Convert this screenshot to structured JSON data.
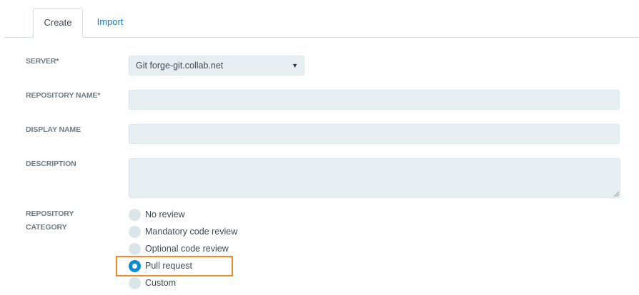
{
  "tabs": {
    "create": "Create",
    "import": "Import"
  },
  "form": {
    "server_label": "SERVER*",
    "server_value": "Git forge-git.collab.net",
    "repo_name_label": "REPOSITORY NAME*",
    "display_name_label": "DISPLAY NAME",
    "description_label": "DESCRIPTION",
    "category_label_line1": "REPOSITORY",
    "category_label_line2": "CATEGORY",
    "category_options": [
      {
        "label": "No review",
        "checked": false
      },
      {
        "label": "Mandatory code review",
        "checked": false
      },
      {
        "label": "Optional code review",
        "checked": false
      },
      {
        "label": "Pull request",
        "checked": true
      },
      {
        "label": "Custom",
        "checked": false
      }
    ]
  },
  "colors": {
    "accent": "#0c8bd0",
    "link": "#1f7ab8",
    "highlight": "#f08a28",
    "field_bg": "#e6eef1"
  },
  "icons": {
    "select_arrow": "chevron-down-icon"
  }
}
